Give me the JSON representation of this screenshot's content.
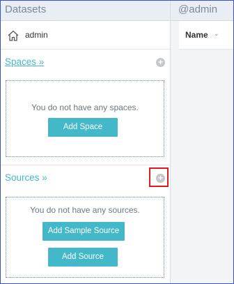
{
  "left_panel": {
    "title": "Datasets",
    "home": {
      "label": "admin",
      "icon": "home-icon"
    },
    "spaces": {
      "title": "Spaces »",
      "add_icon": "plus-circle-icon",
      "empty_text": "You do not have any spaces.",
      "add_button": "Add Space"
    },
    "sources": {
      "title": "Sources »",
      "add_icon": "plus-circle-icon",
      "empty_text": "You do not have any sources.",
      "add_sample_button": "Add Sample Source",
      "add_button": "Add Source"
    }
  },
  "right_panel": {
    "title": "@admin",
    "column": {
      "label": "Name",
      "sort_icon": "chevron-down-icon"
    }
  },
  "colors": {
    "accent": "#43b8c9",
    "header_bg": "#e8eef4",
    "highlight": "#e0191e"
  }
}
